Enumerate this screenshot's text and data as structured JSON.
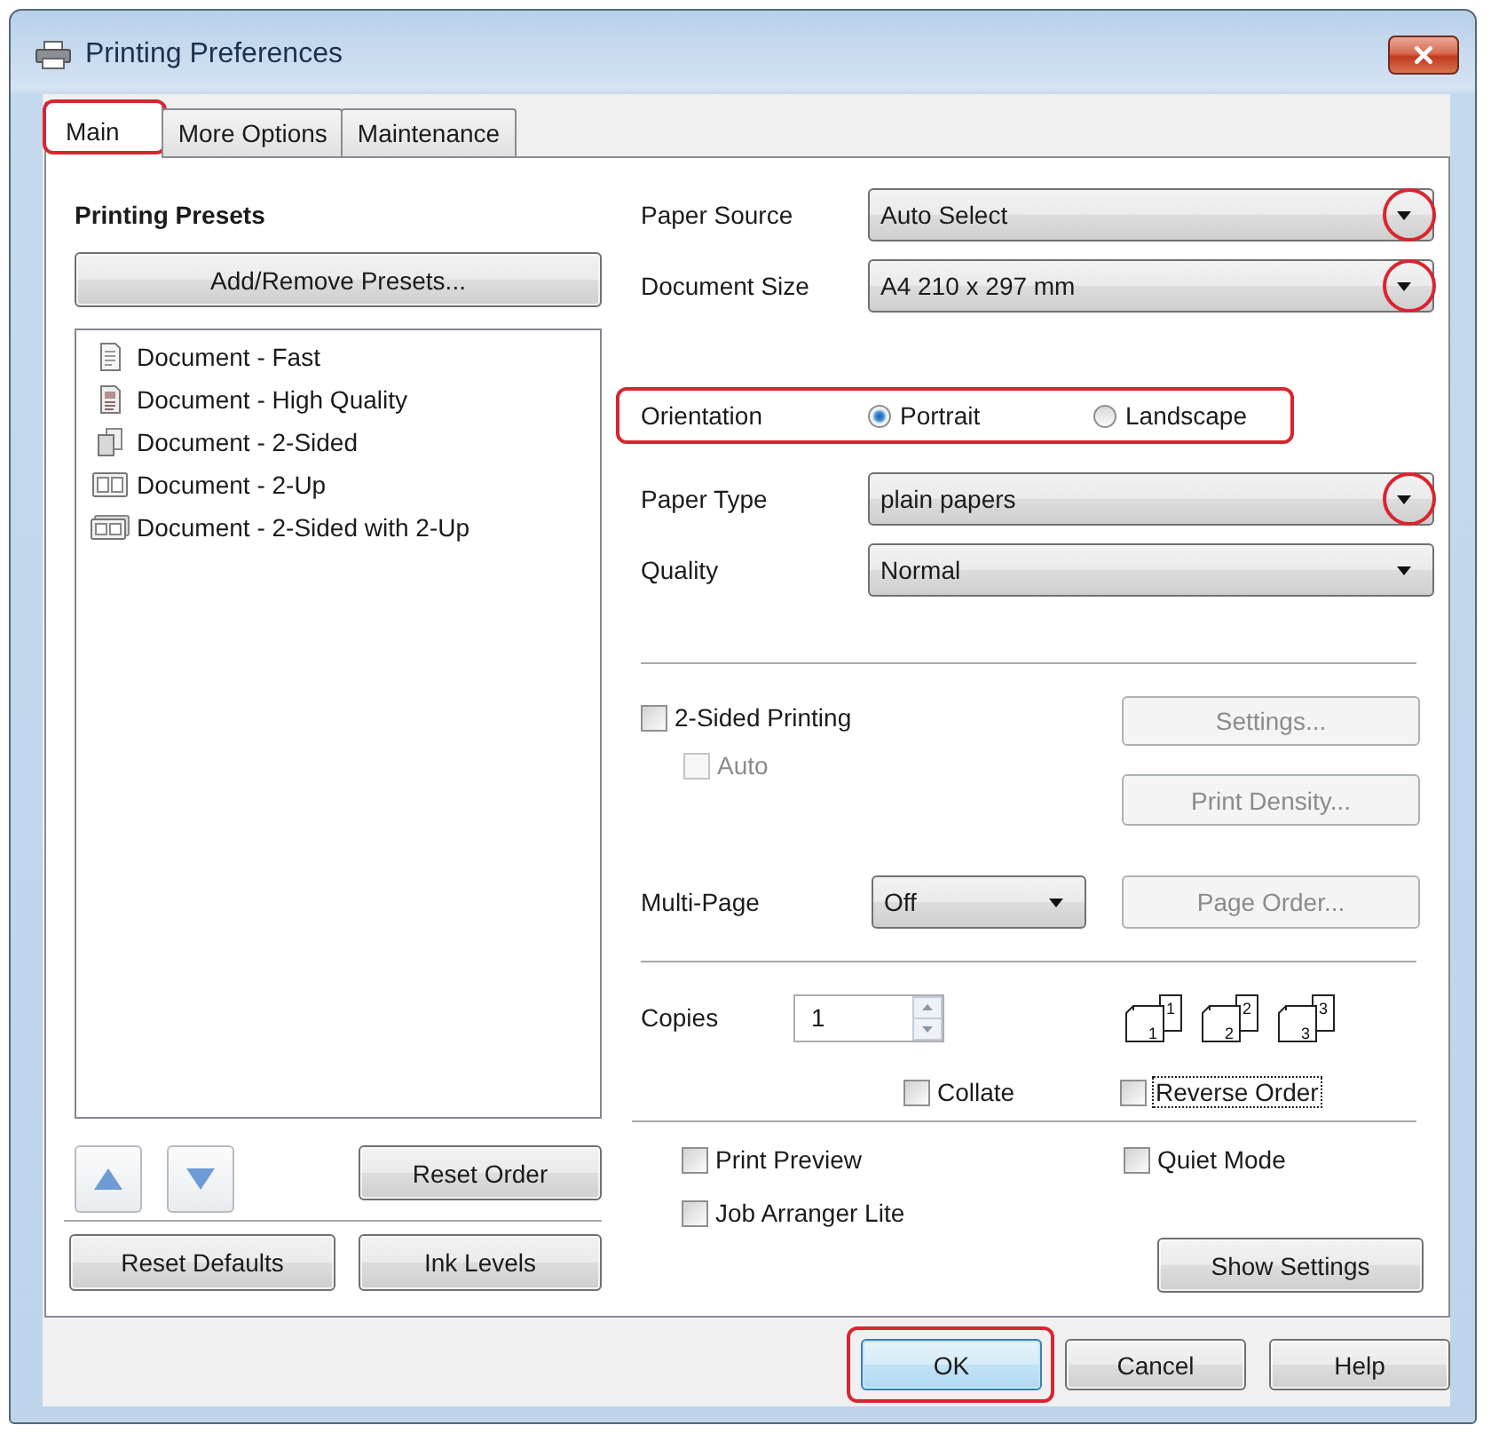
{
  "window": {
    "title": "Printing Preferences"
  },
  "tabs": [
    {
      "label": "Main",
      "selected": true,
      "highlighted": true
    },
    {
      "label": "More Options",
      "selected": false,
      "highlighted": false
    },
    {
      "label": "Maintenance",
      "selected": false,
      "highlighted": false
    }
  ],
  "presets": {
    "title": "Printing Presets",
    "add_button": "Add/Remove Presets...",
    "items": [
      {
        "label": "Document - Fast",
        "kind": "fast"
      },
      {
        "label": "Document - High Quality",
        "kind": "quality"
      },
      {
        "label": "Document - 2-Sided",
        "kind": "two_sided"
      },
      {
        "label": "Document - 2-Up",
        "kind": "two_up"
      },
      {
        "label": "Document - 2-Sided with 2-Up",
        "kind": "two_sided_two_up"
      }
    ],
    "reset_order_button": "Reset Order"
  },
  "left_buttons": [
    "Reset Defaults",
    "Ink Levels"
  ],
  "paper_settings": [
    {
      "kind": "dropdown",
      "label": "Paper Source",
      "value": "Auto Select",
      "highlighted": true
    },
    {
      "kind": "dropdown",
      "label": "Document Size",
      "value": "A4 210 x 297 mm",
      "highlighted": true
    },
    {
      "kind": "radio",
      "label": "Orientation",
      "highlighted": true,
      "options": [
        {
          "label": "Portrait",
          "selected": true
        },
        {
          "label": "Landscape",
          "selected": false
        }
      ]
    },
    {
      "kind": "dropdown",
      "label": "Paper Type",
      "value": "plain papers",
      "highlighted": true
    },
    {
      "kind": "dropdown",
      "label": "Quality",
      "value": "Normal",
      "highlighted": false
    }
  ],
  "two_sided": {
    "checkbox": {
      "label": "2-Sided Printing",
      "checked": false,
      "disabled": false
    },
    "auto": {
      "label": "Auto",
      "checked": false,
      "disabled": true
    },
    "buttons": [
      {
        "label": "Settings...",
        "disabled": true
      },
      {
        "label": "Print Density...",
        "disabled": true
      }
    ]
  },
  "multi_page": {
    "label": "Multi-Page",
    "value": "Off",
    "button": {
      "label": "Page Order...",
      "disabled": true
    }
  },
  "copies": {
    "label": "Copies",
    "value": "1",
    "page_stacks": [
      {
        "front": "1",
        "back": "1"
      },
      {
        "front": "2",
        "back": "2"
      },
      {
        "front": "3",
        "back": "3"
      }
    ]
  },
  "collate": {
    "label": "Collate",
    "checked": false
  },
  "reverse_order": {
    "label": "Reverse Order",
    "checked": false,
    "focused": true
  },
  "options": [
    {
      "label": "Print Preview",
      "checked": false
    },
    {
      "label": "Quiet Mode",
      "checked": false
    },
    {
      "label": "Job Arranger Lite",
      "checked": false
    }
  ],
  "show_settings_button": "Show Settings",
  "dialog_buttons": [
    {
      "label": "OK",
      "default": true,
      "highlighted": true
    },
    {
      "label": "Cancel",
      "default": false,
      "highlighted": false
    },
    {
      "label": "Help",
      "default": false,
      "highlighted": false
    }
  ]
}
